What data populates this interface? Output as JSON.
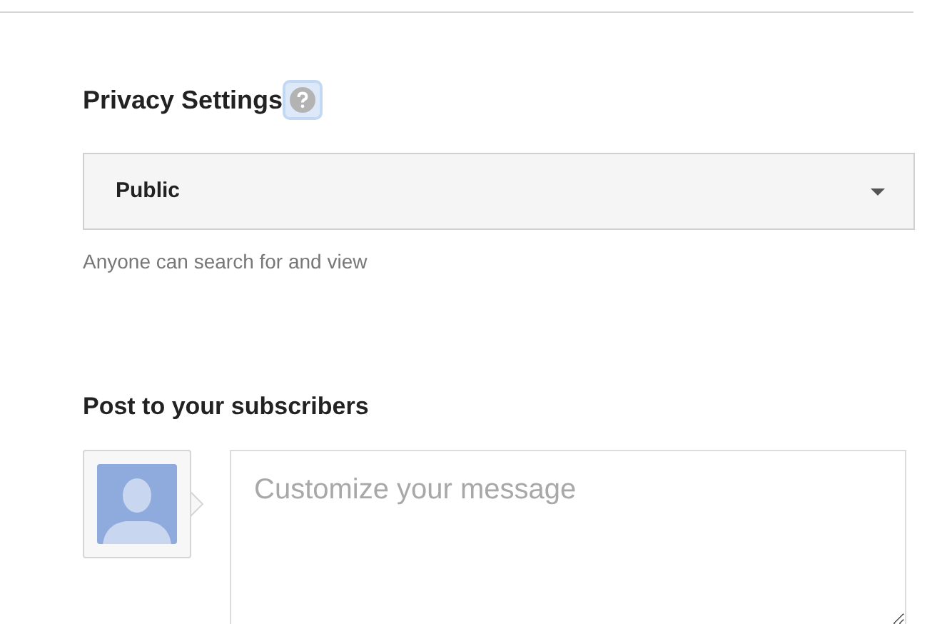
{
  "privacy": {
    "title": "Privacy Settings",
    "help_focused": true,
    "select_value": "Public",
    "hint": "Anyone can search for and view"
  },
  "post": {
    "title": "Post to your subscribers",
    "placeholder": "Customize your message"
  }
}
